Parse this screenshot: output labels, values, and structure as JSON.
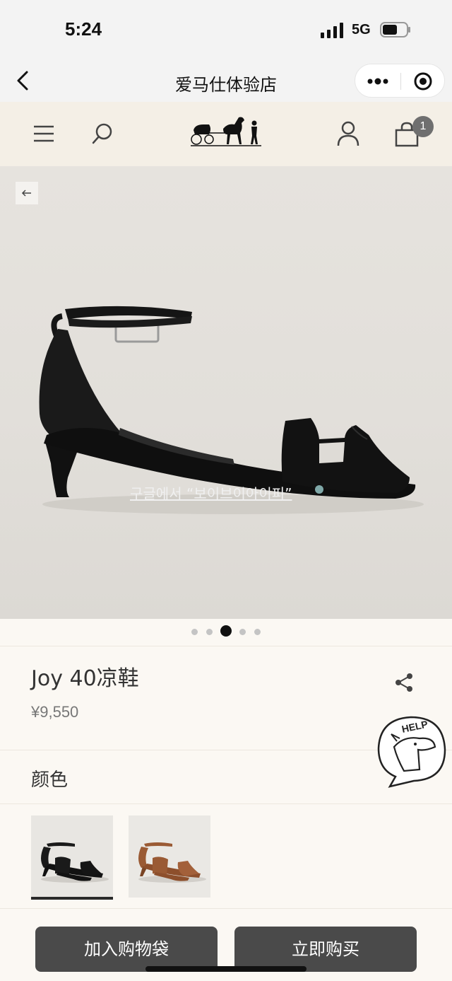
{
  "status_bar": {
    "time": "5:24",
    "network": "5G",
    "icons": [
      "signal-icon",
      "battery-icon"
    ]
  },
  "wechat_nav": {
    "title": "爱马仕体验店",
    "icons": [
      "back-chevron-icon",
      "more-dots-icon",
      "target-circle-icon"
    ]
  },
  "site_header": {
    "icons": [
      "hamburger-menu-icon",
      "search-icon",
      "carriage-logo-icon",
      "user-icon",
      "shopping-bag-icon"
    ],
    "cart_count": "1"
  },
  "gallery": {
    "overlay_text": "구글에서 “보이브이아이피”",
    "total_images": 5,
    "active_index": 2
  },
  "product": {
    "name": "Joy 40凉鞋",
    "price": "¥9,550"
  },
  "color_section": {
    "label": "颜色",
    "swatches": [
      {
        "name": "black",
        "selected": true,
        "color": "#1a1a1a"
      },
      {
        "name": "tan",
        "selected": false,
        "color": "#9a5a34"
      }
    ]
  },
  "help_badge": {
    "text": "HELP"
  },
  "actions": {
    "add_to_bag": "加入购物袋",
    "buy_now": "立即购买"
  },
  "colors": {
    "button_bg": "#4a4a4a",
    "header_bg": "#f4efe6",
    "page_bg": "#fbf8f3"
  }
}
